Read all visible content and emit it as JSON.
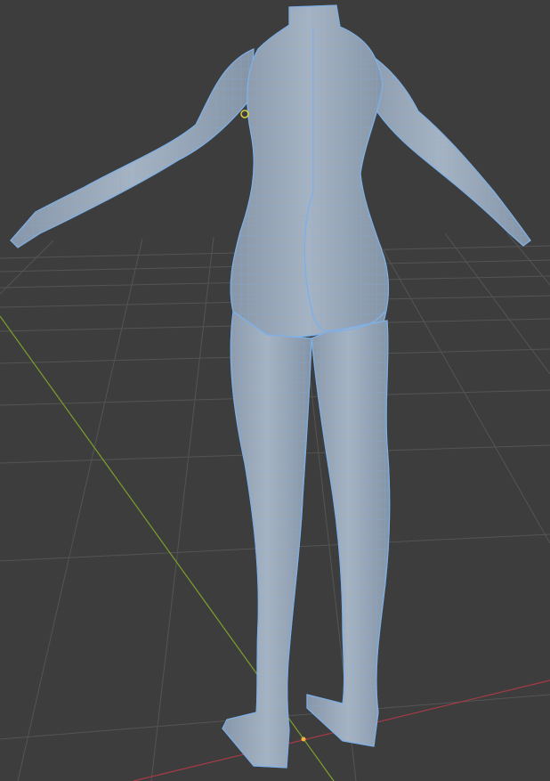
{
  "viewport": {
    "background_color": "#3d3d3d",
    "grid_color": "#555555",
    "x_axis_color": "#a83a48",
    "y_axis_color": "#7aa02c",
    "mesh_fill_color": "#9aa9bb",
    "mesh_wire_color": "#7fb0e6",
    "origin_color": "#f2b43a",
    "light_gizmo_color": "#d8cf3c"
  },
  "scene": {
    "object_icon": "human-mesh-icon",
    "object_mode": "edit-mode-selected"
  }
}
